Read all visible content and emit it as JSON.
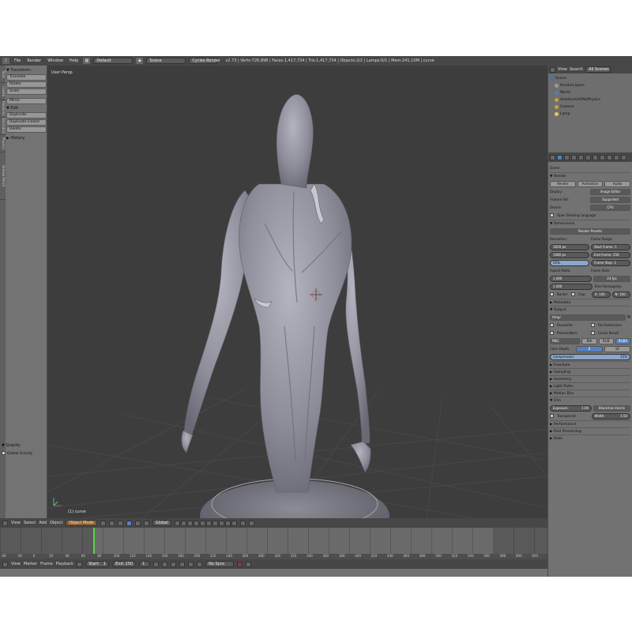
{
  "topbar": {
    "menus": [
      "File",
      "Render",
      "Window",
      "Help"
    ],
    "layout": "Default",
    "scene": "Scene",
    "engine": "Cycles Render",
    "stats": "v2.73 | Verts:726,898 | Faces:1,417,734 | Tris:1,417,734 | Objects:2/2 | Lamps:0/1 | Mem:241.10M | curve"
  },
  "toolshelf": {
    "tabs": [
      "Tools",
      "Create",
      "Relations",
      "Animation",
      "Physics",
      "Grease Pencil"
    ],
    "transform_header": "▼ Transform:",
    "transform_buttons": [
      "Translate",
      "Rotate",
      "Scale",
      "Mirror"
    ],
    "edit_header": "▼ Edit",
    "edit_buttons": [
      "Duplicate",
      "Duplicate Linked",
      "Delete"
    ],
    "history_header": "▶ History",
    "gravity_header": "▼ Gravity",
    "gravity_option": "Global Gravity"
  },
  "viewport": {
    "view_label": "User Persp",
    "object_label": "(1) curve"
  },
  "vheader": {
    "menus": [
      "View",
      "Select",
      "Add",
      "Object"
    ],
    "mode": "Object Mode",
    "pivot": "Global"
  },
  "timeline": {
    "ticks": [
      "-40",
      "-20",
      "0",
      "20",
      "40",
      "60",
      "80",
      "100",
      "120",
      "140",
      "160",
      "180",
      "200",
      "220",
      "240",
      "260",
      "280",
      "300",
      "320",
      "340",
      "360",
      "380",
      "400",
      "420",
      "440",
      "460",
      "480",
      "500",
      "520",
      "540",
      "560",
      "580",
      "600",
      "620"
    ],
    "current_frame": 1,
    "start_label": "Start:",
    "start_value": "1",
    "end_label": "End:",
    "end_value": "250",
    "sync": "No Sync",
    "menus": [
      "View",
      "Marker",
      "Frame",
      "Playback"
    ]
  },
  "outliner": {
    "menus": [
      "View",
      "Search"
    ],
    "filter": "All Scenes",
    "items": [
      "Scene",
      "RenderLayers",
      "World",
      "Armature/AFNoPhysics",
      "Camera",
      "Lamp"
    ]
  },
  "properties": {
    "scene_name": "Scene",
    "render_section": "▼ Render",
    "render_buttons": [
      "Render",
      "Animation",
      "Audio"
    ],
    "display_label": "Display:",
    "display_value": "Image Editor",
    "feature_label": "Feature Set:",
    "feature_value": "Supported",
    "device_label": "Device:",
    "device_value": "CPU",
    "osl": "Open Shading Language",
    "dimensions_section": "▼ Dimensions",
    "preset": "Render Presets",
    "resolution_label": "Resolution:",
    "res_x": "1920 px",
    "res_y": "1080 px",
    "res_pct": "50%",
    "frame_range_label": "Frame Range:",
    "start_frame": "Start Frame: 1",
    "end_frame": "End Frame: 250",
    "frame_step": "Frame Step: 1",
    "aspect_label": "Aspect Ratio:",
    "aspect_x": "1.000",
    "aspect_y": "1.000",
    "frame_rate_label": "Frame Rate:",
    "frame_rate": "24 fps",
    "time_remap": "Time Remapping:",
    "old": "0: 100",
    "new": "N: 100",
    "border": "Border",
    "crop": "Crop",
    "metadata_section": "▶ Metadata",
    "output_section": "▼ Output",
    "output_path": "/tmp/",
    "overwrite": "Overwrite",
    "file_ext": "File Extensions",
    "placeholders": "Placeholders",
    "cache_result": "Cache Result",
    "format": "PNG",
    "bw": "BW",
    "rgb": "RGB",
    "rgba": "RGBA",
    "color_depth_label": "Color Depth:",
    "depth_8": "8",
    "depth_16": "16",
    "compression": "Compression:",
    "compression_value": "15%",
    "freestyle": "▶ Freestyle",
    "sampling": "▶ Sampling",
    "geometry": "▶ Geometry",
    "light_paths": "▶ Light Paths",
    "motion_blur": "▶ Motion Blur",
    "film_section": "▼ Film",
    "exposure": "Exposure:",
    "exposure_value": "1.00",
    "transparent": "Transparent",
    "filter_label": "Blackman-Harris",
    "width_label": "Width:",
    "width_value": "1.50",
    "performance": "▶ Performance",
    "post": "▶ Post Processing",
    "bake": "▶ Bake"
  },
  "colors": {
    "accent": "#5680c2",
    "playhead": "#58d348",
    "viewport_bg": "#3d3d3d",
    "mesh": "#9a9aa6"
  }
}
